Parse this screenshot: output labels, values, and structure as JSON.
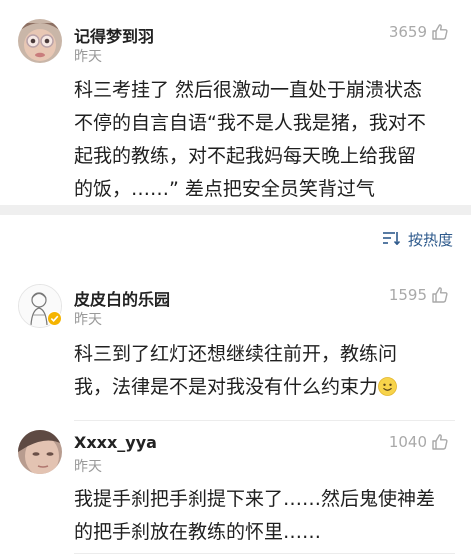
{
  "comments": [
    {
      "user": "记得梦到羽",
      "time": "昨天",
      "likes": "3659",
      "lines": [
        "科三考挂了 然后很激动一直处于崩溃状态",
        "不停的自言自语“我不是人我是猪，我对不",
        "起我的教练，对不起我妈每天晚上给我留",
        "的饭，……” 差点把安全员笑背过气"
      ]
    },
    {
      "user": "皮皮白的乐园",
      "time": "昨天",
      "likes": "1595",
      "verified": true,
      "lines": [
        "科三到了红灯还想继续往前开，教练问",
        "我，法律是不是对我没有什么约束力"
      ],
      "emoji": "slightly-smiling-face"
    },
    {
      "user": "Xxxx_yya",
      "time": "昨天",
      "likes": "1040",
      "lines": [
        "我提手刹把手刹提下来了……然后鬼使神差",
        "的把手刹放在教练的怀里……"
      ]
    }
  ],
  "sort": {
    "label": "按热度",
    "icon": "sort-icon"
  },
  "icons": {
    "like": "thumbs-up-icon",
    "verified": "verified-badge-icon"
  },
  "colors": {
    "link": "#2e5a8c",
    "meta": "#9a9a9a",
    "separator": "#efefef",
    "verified": "#f5b400"
  }
}
